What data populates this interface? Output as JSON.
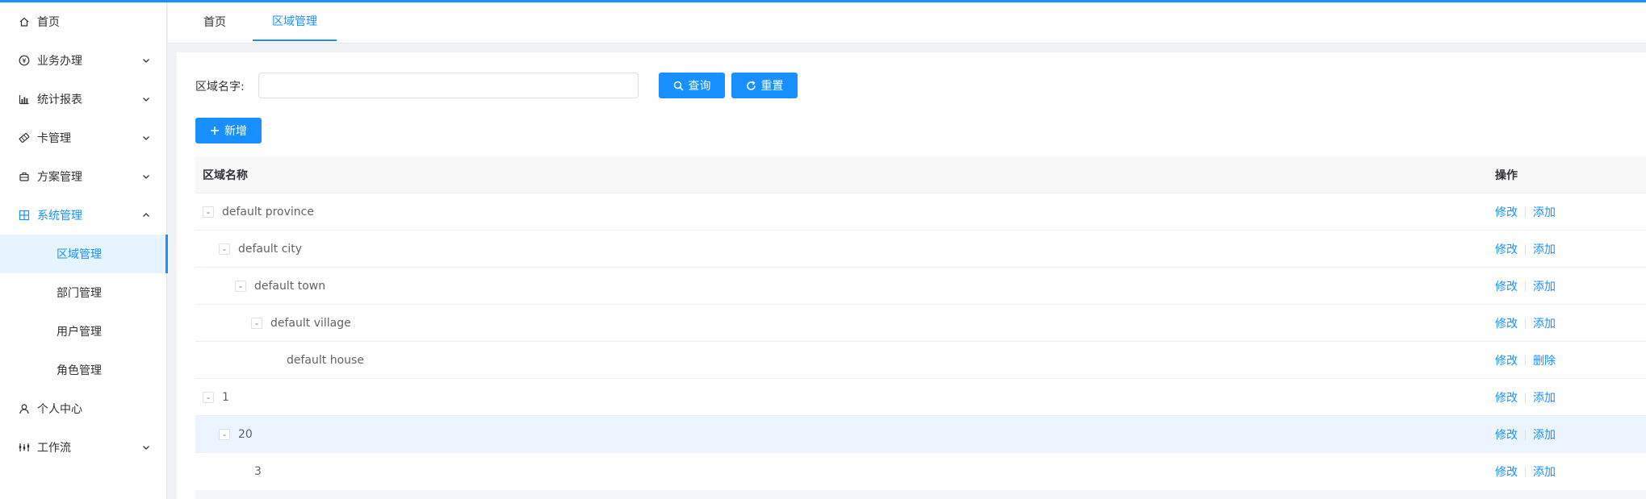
{
  "sidebar": {
    "items": [
      {
        "label": "首页",
        "icon": "home-icon",
        "has_arrow": false,
        "open": false
      },
      {
        "label": "业务办理",
        "icon": "yen-icon",
        "has_arrow": true,
        "open": false
      },
      {
        "label": "统计报表",
        "icon": "chart-icon",
        "has_arrow": true,
        "open": false
      },
      {
        "label": "卡管理",
        "icon": "card-icon",
        "has_arrow": true,
        "open": false
      },
      {
        "label": "方案管理",
        "icon": "briefcase-icon",
        "has_arrow": true,
        "open": false
      },
      {
        "label": "系统管理",
        "icon": "grid-icon",
        "has_arrow": true,
        "open": true
      },
      {
        "label": "个人中心",
        "icon": "user-icon",
        "has_arrow": false,
        "open": false
      },
      {
        "label": "工作流",
        "icon": "workflow-icon",
        "has_arrow": true,
        "open": false
      }
    ],
    "subitems": [
      {
        "label": "区域管理",
        "active": true
      },
      {
        "label": "部门管理",
        "active": false
      },
      {
        "label": "用户管理",
        "active": false
      },
      {
        "label": "角色管理",
        "active": false
      }
    ]
  },
  "tabs": [
    {
      "label": "首页",
      "active": false
    },
    {
      "label": "区域管理",
      "active": true
    }
  ],
  "search": {
    "label": "区域名字:",
    "value": "",
    "placeholder": "",
    "query_button": "查询",
    "reset_button": "重置"
  },
  "toolbar": {
    "add_button": "新增"
  },
  "table": {
    "columns": [
      "区域名称",
      "操作"
    ],
    "rows": [
      {
        "name": "default province",
        "level": 0,
        "toggle": "-",
        "ops": [
          "修改",
          "添加"
        ]
      },
      {
        "name": "default city",
        "level": 1,
        "toggle": "-",
        "ops": [
          "修改",
          "添加"
        ]
      },
      {
        "name": "default town",
        "level": 2,
        "toggle": "-",
        "ops": [
          "修改",
          "添加"
        ]
      },
      {
        "name": "default village",
        "level": 3,
        "toggle": "-",
        "ops": [
          "修改",
          "添加"
        ]
      },
      {
        "name": "default house",
        "level": 4,
        "toggle": "",
        "ops": [
          "修改",
          "删除"
        ]
      },
      {
        "name": "1",
        "level": 0,
        "toggle": "-",
        "ops": [
          "修改",
          "添加"
        ]
      },
      {
        "name": "20",
        "level": 1,
        "toggle": "-",
        "ops": [
          "修改",
          "添加"
        ],
        "hover": true
      },
      {
        "name": "3",
        "level": 2,
        "toggle": "",
        "ops": [
          "修改",
          "添加"
        ]
      }
    ]
  },
  "colors": {
    "primary": "#1890ff",
    "active_bg": "#e6f4ff",
    "hover_row": "#ecf5ff"
  }
}
